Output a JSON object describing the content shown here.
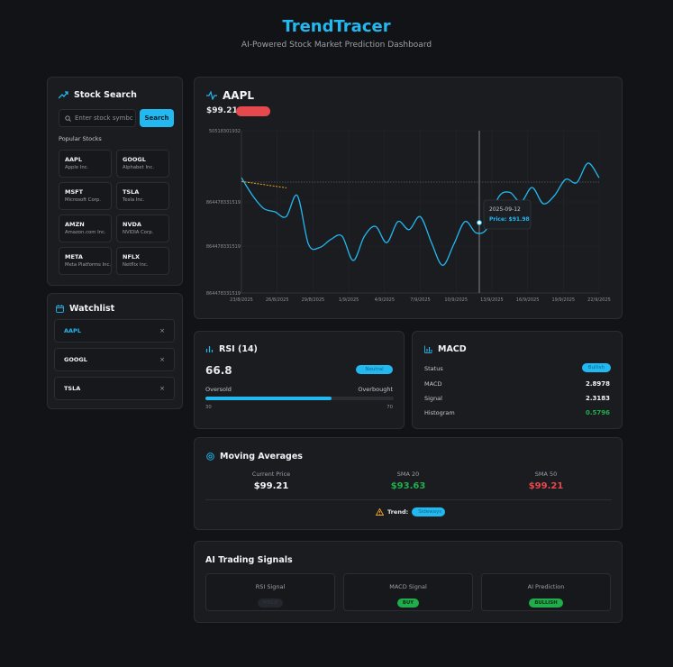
{
  "header": {
    "title": "TrendTracer",
    "subtitle": "AI-Powered Stock Market Prediction Dashboard"
  },
  "search": {
    "title": "Stock Search",
    "placeholder": "Enter stock symbc",
    "button": "Search",
    "popular_label": "Popular Stocks",
    "popular": [
      {
        "symbol": "AAPL",
        "name": "Apple Inc."
      },
      {
        "symbol": "GOOGL",
        "name": "Alphabet Inc."
      },
      {
        "symbol": "MSFT",
        "name": "Microsoft Corp."
      },
      {
        "symbol": "TSLA",
        "name": "Tesla Inc."
      },
      {
        "symbol": "AMZN",
        "name": "Amazon.com Inc."
      },
      {
        "symbol": "NVDA",
        "name": "NVIDIA Corp."
      },
      {
        "symbol": "META",
        "name": "Meta Platforms Inc."
      },
      {
        "symbol": "NFLX",
        "name": "Netflix Inc."
      }
    ]
  },
  "watchlist": {
    "title": "Watchlist",
    "items": [
      {
        "symbol": "AAPL",
        "active": true
      },
      {
        "symbol": "GOOGL",
        "active": false
      },
      {
        "symbol": "TSLA",
        "active": false
      }
    ],
    "remove_glyph": "×"
  },
  "stock": {
    "symbol": "AAPL",
    "price": "$99.21"
  },
  "chart_data": {
    "type": "line",
    "series": [
      {
        "values": [
          [
            "23/8/2025",
            0.71
          ],
          [
            "23/8/2025",
            0.6
          ],
          [
            "24/8/2025",
            0.52
          ],
          [
            "25/8/2025",
            0.5
          ],
          [
            "26/8/2025",
            0.47
          ],
          [
            "26/8/2025",
            0.6
          ],
          [
            "27/8/2025",
            0.3
          ],
          [
            "28/8/2025",
            0.28
          ],
          [
            "29/8/2025",
            0.33
          ],
          [
            "30/8/2025",
            0.35
          ],
          [
            "31/8/2025",
            0.2
          ],
          [
            "1/9/2025",
            0.35
          ],
          [
            "2/9/2025",
            0.41
          ],
          [
            "3/9/2025",
            0.31
          ],
          [
            "4/9/2025",
            0.44
          ],
          [
            "5/9/2025",
            0.39
          ],
          [
            "6/9/2025",
            0.47
          ],
          [
            "7/9/2025",
            0.31
          ],
          [
            "8/9/2025",
            0.17
          ],
          [
            "9/9/2025",
            0.3
          ],
          [
            "10/9/2025",
            0.44
          ],
          [
            "11/9/2025",
            0.37
          ],
          [
            "12/9/2025",
            0.4
          ],
          [
            "13/9/2025",
            0.59
          ],
          [
            "14/9/2025",
            0.62
          ],
          [
            "15/9/2025",
            0.56
          ],
          [
            "16/9/2025",
            0.65
          ],
          [
            "17/9/2025",
            0.55
          ],
          [
            "18/9/2025",
            0.6
          ],
          [
            "19/9/2025",
            0.7
          ],
          [
            "20/9/2025",
            0.68
          ],
          [
            "21/9/2025",
            0.8
          ],
          [
            "22/9/2025",
            0.71
          ]
        ]
      },
      {
        "values": [
          [
            "23/8/2025",
            0.71
          ],
          [
            "24/8/2025",
            0.7
          ],
          [
            "25/8/2025",
            0.69
          ],
          [
            "26/8/2025",
            0.68
          ],
          [
            "27/8/2025",
            0.67
          ]
        ]
      }
    ],
    "x_ticks": [
      "23/8/2025",
      "26/8/2025",
      "29/8/2025",
      "1/9/2025",
      "4/9/2025",
      "7/9/2025",
      "10/9/2025",
      "13/9/2025",
      "16/9/2025",
      "19/9/2025",
      "22/9/2025"
    ],
    "y_ticks": [
      "50518301932",
      "864478331519",
      "864478331519",
      "864478331519"
    ],
    "tooltip": {
      "date": "2025-09-12",
      "label": "Price: $91.98"
    },
    "grid": true
  },
  "rsi": {
    "title": "RSI (14)",
    "value": "66.8",
    "fraction": 0.668,
    "badge": "Neutral",
    "oversold_label": "Oversold",
    "overbought_label": "Overbought",
    "low": "30",
    "high": "70"
  },
  "macd": {
    "title": "MACD",
    "status_label": "Status",
    "status_badge": "Bullish",
    "rows": [
      {
        "label": "MACD",
        "value": "2.8978"
      },
      {
        "label": "Signal",
        "value": "2.3183"
      },
      {
        "label": "Histogram",
        "value": "0.5796"
      }
    ]
  },
  "moving_averages": {
    "title": "Moving Averages",
    "cols": [
      {
        "label": "Current Price",
        "value": "$99.21"
      },
      {
        "label": "SMA 20",
        "value": "$93.63"
      },
      {
        "label": "SMA 50",
        "value": "$99.21"
      }
    ],
    "trend_label": "Trend:",
    "trend_badge": "Sideways"
  },
  "signals": {
    "title": "AI Trading Signals",
    "items": [
      {
        "label": "RSI Signal",
        "badge": "HOLD"
      },
      {
        "label": "MACD Signal",
        "badge": "BUY"
      },
      {
        "label": "AI Prediction",
        "badge": "BULLISH"
      }
    ]
  },
  "colors": {
    "accent": "#22b8f0",
    "green": "#1fae4b",
    "red": "#e5484d",
    "bg": "#121316",
    "card": "#1a1c20"
  }
}
